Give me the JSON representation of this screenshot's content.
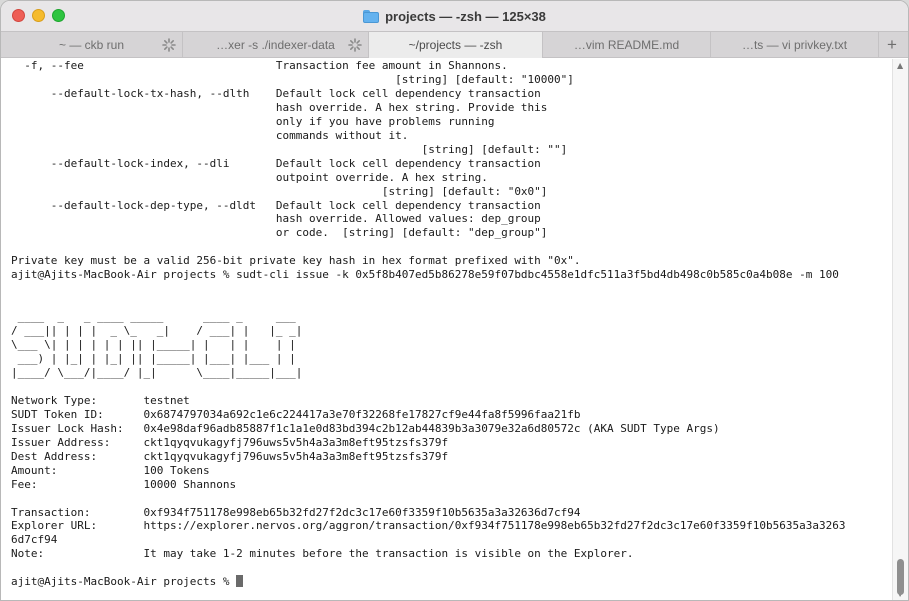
{
  "window": {
    "title": "projects — -zsh — 125×38"
  },
  "tabs": [
    {
      "label": "~ — ckb run",
      "active": false,
      "busy": true
    },
    {
      "label": "…xer -s ./indexer-data",
      "active": false,
      "busy": true
    },
    {
      "label": "~/projects — -zsh",
      "active": true,
      "busy": false
    },
    {
      "label": "…vim README.md",
      "active": false,
      "busy": false
    },
    {
      "label": "…ts — vi privkey.txt",
      "active": false,
      "busy": false
    }
  ],
  "new_tab_label": "+",
  "terminal": {
    "lines": [
      "  -f, --fee                             Transaction fee amount in Shannons.",
      "                                                          [string] [default: \"10000\"]",
      "      --default-lock-tx-hash, --dlth    Default lock cell dependency transaction",
      "                                        hash override. A hex string. Provide this",
      "                                        only if you have problems running",
      "                                        commands without it.",
      "                                                              [string] [default: \"\"]",
      "      --default-lock-index, --dli       Default lock cell dependency transaction",
      "                                        outpoint override. A hex string.",
      "                                                        [string] [default: \"0x0\"]",
      "      --default-lock-dep-type, --dldt   Default lock cell dependency transaction",
      "                                        hash override. Allowed values: dep_group",
      "                                        or code.  [string] [default: \"dep_group\"]",
      "",
      "Private key must be a valid 256-bit private key hash in hex format prefixed with \"0x\".",
      "ajit@Ajits-MacBook-Air projects % sudt-cli issue -k 0x5f8b407ed5b86278e59f07bdbc4558e1dfc511a3f5bd4db498c0b585c0a4b08e -m 100",
      "",
      "",
      " ____  _   _ ____ _____      ____ _     ___",
      "/ ___|| | | |  _ \\_   _|    / ___| |   |_ _|",
      "\\___ \\| | | | | | || |_____| |   | |    | |",
      " ___) | |_| | |_| || |_____| |___| |___ | |",
      "|____/ \\___/|____/ |_|      \\____|_____|___|",
      "",
      "Network Type:       testnet",
      "SUDT Token ID:      0x6874797034a692c1e6c224417a3e70f32268fe17827cf9e44fa8f5996faa21fb",
      "Issuer Lock Hash:   0x4e98daf96adb85887f1c1a1e0d83bd394c2b12ab44839b3a3079e32a6d80572c (AKA SUDT Type Args)",
      "Issuer Address:     ckt1qyqvukagyfj796uws5v5h4a3a3m8eft95tzsfs379f",
      "Dest Address:       ckt1qyqvukagyfj796uws5v5h4a3a3m8eft95tzsfs379f",
      "Amount:             100 Tokens",
      "Fee:                10000 Shannons",
      "",
      "Transaction:        0xf934f751178e998eb65b32fd27f2dc3c17e60f3359f10b5635a3a32636d7cf94",
      "Explorer URL:       https://explorer.nervos.org/aggron/transaction/0xf934f751178e998eb65b32fd27f2dc3c17e60f3359f10b5635a3a3263",
      "6d7cf94",
      "Note:               It may take 1-2 minutes before the transaction is visible on the Explorer.",
      ""
    ],
    "prompt": "ajit@Ajits-MacBook-Air projects % "
  }
}
